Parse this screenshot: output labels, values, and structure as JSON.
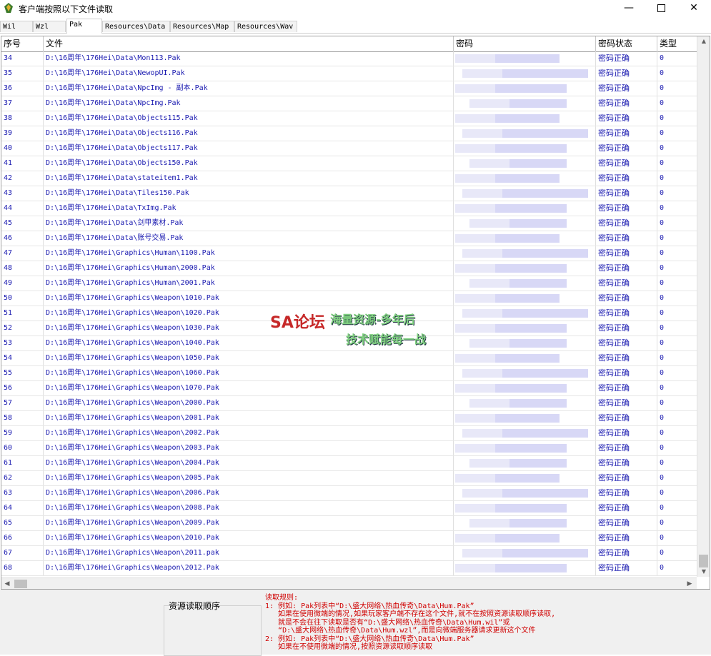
{
  "window": {
    "title": "客户端按照以下文件读取",
    "controls": {
      "minimize": "—",
      "maximize": "",
      "close": "✕"
    }
  },
  "tabs": [
    "Wil",
    "Wzl",
    "Pak",
    "Resources\\Data",
    "Resources\\Map",
    "Resources\\Wav"
  ],
  "active_tab": "Pak",
  "table": {
    "columns": [
      "序号",
      "文件",
      "密码",
      "密码状态",
      "类型"
    ],
    "rows": [
      {
        "idx": "34",
        "file": "D:\\16周年\\176Hei\\Data\\Mon113.Pak",
        "status": "密码正确",
        "type": "0"
      },
      {
        "idx": "35",
        "file": "D:\\16周年\\176Hei\\Data\\NewopUI.Pak",
        "status": "密码正确",
        "type": "0"
      },
      {
        "idx": "36",
        "file": "D:\\16周年\\176Hei\\Data\\NpcImg - 副本.Pak",
        "status": "密码正确",
        "type": "0"
      },
      {
        "idx": "37",
        "file": "D:\\16周年\\176Hei\\Data\\NpcImg.Pak",
        "status": "密码正确",
        "type": "0"
      },
      {
        "idx": "38",
        "file": "D:\\16周年\\176Hei\\Data\\Objects115.Pak",
        "status": "密码正确",
        "type": "0"
      },
      {
        "idx": "39",
        "file": "D:\\16周年\\176Hei\\Data\\Objects116.Pak",
        "status": "密码正确",
        "type": "0"
      },
      {
        "idx": "40",
        "file": "D:\\16周年\\176Hei\\Data\\Objects117.Pak",
        "status": "密码正确",
        "type": "0"
      },
      {
        "idx": "41",
        "file": "D:\\16周年\\176Hei\\Data\\Objects150.Pak",
        "status": "密码正确",
        "type": "0"
      },
      {
        "idx": "42",
        "file": "D:\\16周年\\176Hei\\Data\\stateitem1.Pak",
        "status": "密码正确",
        "type": "0"
      },
      {
        "idx": "43",
        "file": "D:\\16周年\\176Hei\\Data\\Tiles150.Pak",
        "status": "密码正确",
        "type": "0"
      },
      {
        "idx": "44",
        "file": "D:\\16周年\\176Hei\\Data\\TxImg.Pak",
        "status": "密码正确",
        "type": "0"
      },
      {
        "idx": "45",
        "file": "D:\\16周年\\176Hei\\Data\\剑甲素材.Pak",
        "status": "密码正确",
        "type": "0"
      },
      {
        "idx": "46",
        "file": "D:\\16周年\\176Hei\\Data\\账号交易.Pak",
        "status": "密码正确",
        "type": "0"
      },
      {
        "idx": "47",
        "file": "D:\\16周年\\176Hei\\Graphics\\Human\\1100.Pak",
        "status": "密码正确",
        "type": "0"
      },
      {
        "idx": "48",
        "file": "D:\\16周年\\176Hei\\Graphics\\Human\\2000.Pak",
        "status": "密码正确",
        "type": "0"
      },
      {
        "idx": "49",
        "file": "D:\\16周年\\176Hei\\Graphics\\Human\\2001.Pak",
        "status": "密码正确",
        "type": "0"
      },
      {
        "idx": "50",
        "file": "D:\\16周年\\176Hei\\Graphics\\Weapon\\1010.Pak",
        "status": "密码正确",
        "type": "0"
      },
      {
        "idx": "51",
        "file": "D:\\16周年\\176Hei\\Graphics\\Weapon\\1020.Pak",
        "status": "密码正确",
        "type": "0"
      },
      {
        "idx": "52",
        "file": "D:\\16周年\\176Hei\\Graphics\\Weapon\\1030.Pak",
        "status": "密码正确",
        "type": "0"
      },
      {
        "idx": "53",
        "file": "D:\\16周年\\176Hei\\Graphics\\Weapon\\1040.Pak",
        "status": "密码正确",
        "type": "0"
      },
      {
        "idx": "54",
        "file": "D:\\16周年\\176Hei\\Graphics\\Weapon\\1050.Pak",
        "status": "密码正确",
        "type": "0"
      },
      {
        "idx": "55",
        "file": "D:\\16周年\\176Hei\\Graphics\\Weapon\\1060.Pak",
        "status": "密码正确",
        "type": "0"
      },
      {
        "idx": "56",
        "file": "D:\\16周年\\176Hei\\Graphics\\Weapon\\1070.Pak",
        "status": "密码正确",
        "type": "0"
      },
      {
        "idx": "57",
        "file": "D:\\16周年\\176Hei\\Graphics\\Weapon\\2000.Pak",
        "status": "密码正确",
        "type": "0"
      },
      {
        "idx": "58",
        "file": "D:\\16周年\\176Hei\\Graphics\\Weapon\\2001.Pak",
        "status": "密码正确",
        "type": "0"
      },
      {
        "idx": "59",
        "file": "D:\\16周年\\176Hei\\Graphics\\Weapon\\2002.Pak",
        "status": "密码正确",
        "type": "0"
      },
      {
        "idx": "60",
        "file": "D:\\16周年\\176Hei\\Graphics\\Weapon\\2003.Pak",
        "status": "密码正确",
        "type": "0"
      },
      {
        "idx": "61",
        "file": "D:\\16周年\\176Hei\\Graphics\\Weapon\\2004.Pak",
        "status": "密码正确",
        "type": "0"
      },
      {
        "idx": "62",
        "file": "D:\\16周年\\176Hei\\Graphics\\Weapon\\2005.Pak",
        "status": "密码正确",
        "type": "0"
      },
      {
        "idx": "63",
        "file": "D:\\16周年\\176Hei\\Graphics\\Weapon\\2006.Pak",
        "status": "密码正确",
        "type": "0"
      },
      {
        "idx": "64",
        "file": "D:\\16周年\\176Hei\\Graphics\\Weapon\\2008.Pak",
        "status": "密码正确",
        "type": "0"
      },
      {
        "idx": "65",
        "file": "D:\\16周年\\176Hei\\Graphics\\Weapon\\2009.Pak",
        "status": "密码正确",
        "type": "0"
      },
      {
        "idx": "66",
        "file": "D:\\16周年\\176Hei\\Graphics\\Weapon\\2010.Pak",
        "status": "密码正确",
        "type": "0"
      },
      {
        "idx": "67",
        "file": "D:\\16周年\\176Hei\\Graphics\\Weapon\\2011.pak",
        "status": "密码正确",
        "type": "0"
      },
      {
        "idx": "68",
        "file": "D:\\16周年\\176Hei\\Graphics\\Weapon\\2012.Pak",
        "status": "密码正确",
        "type": "0"
      }
    ]
  },
  "watermark": {
    "logo": "SA论坛",
    "line1": "海量资源-多年后",
    "line2": "技术赋能每一战"
  },
  "bottom": {
    "order_label": "资源读取顺序",
    "rules_text": "读取规则:\n1: 例如: Pak列表中“D:\\盛大网络\\热血传奇\\Data\\Hum.Pak”\n   如果在使用微端的情况,如果玩家客户端不存在这个文件,就不在按照资源读取顺序读取,\n   就是不会在往下读取是否有“D:\\盛大网络\\热血传奇\\Data\\Hum.wil”或\n   “D:\\盛大网络\\热血传奇\\Data\\Hum.wzl”,而是向微端服务器请求更新这个文件\n2: 例如: Pak列表中“D:\\盛大网络\\热血传奇\\Data\\Hum.Pak”\n   如果在不使用微端的情况,按照资源读取顺序读取"
  },
  "colors": {
    "row_text": "#1a1ab0",
    "rules_text": "#d00000",
    "watermark_logo": "#c62828",
    "watermark_text": "#7fd07f"
  }
}
